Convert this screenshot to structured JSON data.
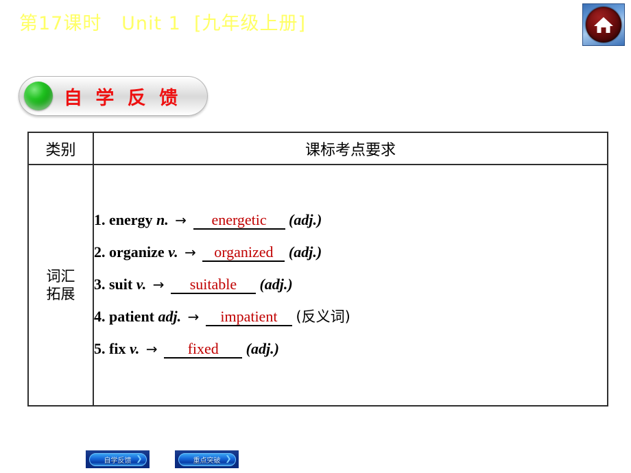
{
  "slide": {
    "title": "第17课时   Unit 1  [九年级上册]",
    "home_icon": "home-icon"
  },
  "section": {
    "badge_label": "自 学 反 馈",
    "dot_color": "#22c322",
    "label_color": "#ee1111"
  },
  "table": {
    "headers": [
      "类别",
      "课标考点要求"
    ],
    "category_lines": [
      "词汇",
      "拓展"
    ],
    "answer_color": "#c00000",
    "rows": [
      {
        "num": "1.",
        "word": "energy",
        "pos": "n.",
        "arrow": "→",
        "answer": "energetic",
        "tail": "(adj.)",
        "tail_type": "italic"
      },
      {
        "num": "2.",
        "word": "organize",
        "pos": "v.",
        "arrow": "→",
        "answer": "organized",
        "tail": "(adj.)",
        "tail_type": "italic"
      },
      {
        "num": "3.",
        "word": "suit",
        "pos": "v.",
        "arrow": "→",
        "answer": "suitable",
        "tail": "(adj.)",
        "tail_type": "italic"
      },
      {
        "num": "4.",
        "word": "patient",
        "pos": "adj.",
        "arrow": "→",
        "answer": "impatient",
        "tail": "(反义词)",
        "tail_type": "chinese"
      },
      {
        "num": "5.",
        "word": "fix",
        "pos": "v.",
        "arrow": "→",
        "answer": "fixed",
        "tail": "(adj.)",
        "tail_type": "italic"
      }
    ]
  },
  "nav": {
    "buttons": [
      {
        "label": "自学反馈",
        "arrow": "❯"
      },
      {
        "label": "重点突破",
        "arrow": "❯"
      }
    ]
  }
}
